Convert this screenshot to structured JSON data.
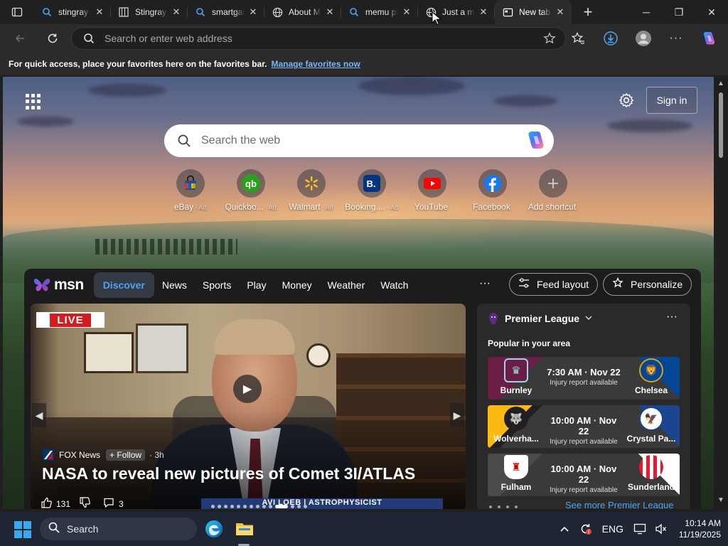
{
  "browser": {
    "tabs": [
      {
        "title": "stingray",
        "icon": "search-icon",
        "active": false
      },
      {
        "title": "Stingray",
        "icon": "page-icon",
        "active": false
      },
      {
        "title": "smartgame",
        "icon": "search-icon",
        "active": false
      },
      {
        "title": "About M",
        "icon": "globe-icon",
        "active": false
      },
      {
        "title": "memu pla",
        "icon": "search-icon",
        "active": false
      },
      {
        "title": "Just a mo",
        "icon": "globe-icon",
        "active": false
      },
      {
        "title": "New tab",
        "icon": "newtab-icon",
        "active": true
      }
    ],
    "new_tab_symbol": "+",
    "window_controls": {
      "minimize": "─",
      "restore": "❐",
      "close": "✕"
    }
  },
  "toolbar": {
    "address_placeholder": "Search or enter web address",
    "address_value": ""
  },
  "favorites_bar": {
    "message": "For quick access, place your favorites here on the favorites bar.",
    "link": "Manage favorites now"
  },
  "newtab": {
    "signin_label": "Sign in",
    "search_placeholder": "Search the web",
    "shortcuts": [
      {
        "label": "eBay",
        "ad": "· Ad",
        "icon": "ebay-icon"
      },
      {
        "label": "Quickbo...",
        "ad": "· Ad",
        "icon": "quickbooks-icon"
      },
      {
        "label": "Walmart",
        "ad": "· Ad",
        "icon": "walmart-icon"
      },
      {
        "label": "Booking....",
        "ad": "· Ad",
        "icon": "booking-icon"
      },
      {
        "label": "YouTube",
        "ad": "",
        "icon": "youtube-icon"
      },
      {
        "label": "Facebook",
        "ad": "",
        "icon": "facebook-icon"
      },
      {
        "label": "Add shortcut",
        "ad": "",
        "icon": "plus-icon"
      }
    ]
  },
  "msn": {
    "logo_text": "msn",
    "tabs": [
      "Discover",
      "News",
      "Sports",
      "Play",
      "Money",
      "Weather",
      "Watch"
    ],
    "active_tab": "Discover",
    "more": "···",
    "feed_layout_label": "Feed layout",
    "personalize_label": "Personalize"
  },
  "hero": {
    "live_label": "LIVE",
    "source": "FOX News",
    "follow_label": "+ Follow",
    "age": "· 3h",
    "title": "NASA to reveal new pictures of Comet 3I/ATLAS",
    "likes": "131",
    "comments": "3",
    "chyron": "AVI LOEB | ASTROPHYSICIST"
  },
  "sports": {
    "league": "Premier League",
    "subtitle": "Popular in your area",
    "more": "···",
    "matches": [
      {
        "home": "Burnley",
        "away": "Chelsea",
        "time": "7:30 AM · Nov 22",
        "status": "Injury report available"
      },
      {
        "home": "Wolverha...",
        "away": "Crystal Pa...",
        "time": "10:00 AM · Nov 22",
        "status": "Injury report available"
      },
      {
        "home": "Fulham",
        "away": "Sunderland",
        "time": "10:00 AM · Nov 22",
        "status": "Injury report available"
      }
    ],
    "see_more": "See more Premier League",
    "colors": {
      "burnley": "#6c1d45",
      "chelsea": "#034694",
      "wolves": "#fdb913",
      "crystal_palace": "#1b458f",
      "fulham": "#ffffff",
      "sunderland": "#eb172b"
    }
  },
  "taskbar": {
    "search_placeholder": "Search",
    "language": "ENG",
    "time": "10:14 AM",
    "date": "11/19/2025"
  },
  "colors": {
    "accent": "#4ea3f5",
    "link": "#7ab7f5",
    "live_red": "#cf1f22"
  }
}
